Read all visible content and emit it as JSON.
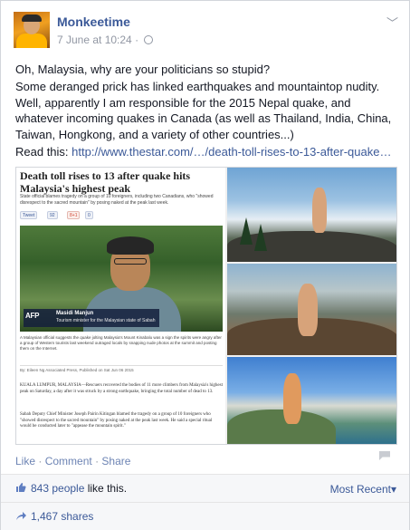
{
  "post": {
    "author": "Monkeetime",
    "timestamp": "7 June at 10:24",
    "meta_separator": "·",
    "menu_icon": "chevron-down-icon",
    "privacy_icon": "globe-icon",
    "line1": "Oh, Malaysia, why are your politicians so stupid?",
    "line2": "Some deranged prick has linked earthquakes and mountaintop nudity. Well, apparently I am responsible for the 2015 Nepal quake, and whatever incoming quakes in Canada (as well as Thailand, India, China, Taiwan, Hongkong, and a variety of other countries...)",
    "read_prefix": "Read this: ",
    "read_link": "http://www.thestar.com/…/death-toll-rises-to-13-after-quake…"
  },
  "article": {
    "headline": "Death toll rises to 13 after quake hits Malaysia's highest peak",
    "subhead": "State official blames tragedy on a group of 10 foreigners, including two Canadians, who \"showed disrespect to the sacred mountain\" by posing naked at the peak last week.",
    "share_tweet": "Tweet",
    "share_tweet_count": "92",
    "share_gplus": "8+1",
    "share_gplus_count": "0",
    "share_misc": "",
    "video_logo": "AFP",
    "lower_third_name": "Masidi Manjun",
    "lower_third_role": "Tourism minister for the Malaysian state of Sabah",
    "caption": "A Malaysian official suggests the quake jolting Malaysia's Mount Kinabalu was a sign the spirits were angry after a group of Western tourists last weekend outraged locals by snapping nude photos at the summit and posting them on the Internet.",
    "byline": "By: Eileen Ng Associated Press, Published on Sat Jun 06 2015",
    "body1": "KUALA LUMPUR, MALAYSIA—Rescuers recovered the bodies of 11 more climbers from Malaysia's highest peak on Saturday, a day after it was struck by a strong earthquake, bringing the total number of dead to 13.",
    "body2": "Sabah Deputy Chief Minister Joseph Pairin Kitingan blamed the tragedy on a group of 10 foreigners who \"showed disrespect to the sacred mountain\" by posing naked at the peak last week. He said a special ritual would be conducted later to \"appease the mountain spirit.\""
  },
  "actions": {
    "like": "Like",
    "comment": "Comment",
    "share": "Share",
    "dot": "·",
    "tag_icon": "tag-icon"
  },
  "likes": {
    "count": "843 people",
    "suffix": " like this.",
    "sort": "Most Recent",
    "sort_caret": "▾",
    "like_icon": "thumbs-up-icon"
  },
  "shares": {
    "count": "1,467 shares",
    "share_icon": "share-arrow-icon"
  },
  "colors": {
    "link": "#3b5998",
    "muted": "#9197a3",
    "text": "#141823"
  }
}
